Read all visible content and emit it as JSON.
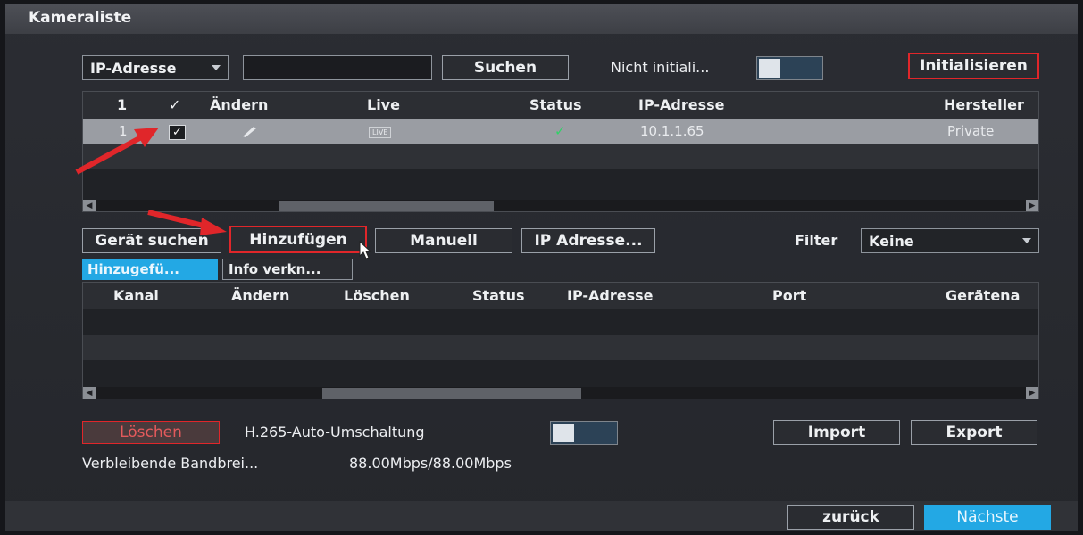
{
  "window": {
    "title": "Kameraliste"
  },
  "search_bar": {
    "type_select": "IP-Adresse",
    "search_value": "",
    "search_button": "Suchen",
    "uninit_label": "Nicht initiali...",
    "init_button": "Initialisieren"
  },
  "device_table": {
    "columns": [
      "1",
      "✓",
      "Ändern",
      "Live",
      "Status",
      "IP-Adresse",
      "Hersteller"
    ],
    "rows": [
      {
        "num": "1",
        "checked": true,
        "live": "LIVE",
        "status": "✓",
        "ip": "10.1.1.65",
        "manufacturer": "Private"
      }
    ]
  },
  "actions": {
    "device_search": "Gerät suchen",
    "add": "Hinzufügen",
    "manual": "Manuell",
    "ip_address": "IP Adresse...",
    "filter_label": "Filter",
    "filter_value": "Keine"
  },
  "tabs": [
    "Hinzugefü...",
    "Info verkn..."
  ],
  "added_table": {
    "columns": [
      "Kanal",
      "Ändern",
      "Löschen",
      "Status",
      "IP-Adresse",
      "Port",
      "Gerätena"
    ]
  },
  "footer": {
    "delete_button": "Löschen",
    "h265_label": "H.265-Auto-Umschaltung",
    "import_button": "Import",
    "export_button": "Export",
    "bandwidth_label": "Verbleibende Bandbrei...",
    "bandwidth_value": "88.00Mbps/88.00Mbps",
    "back_button": "zurück",
    "next_button": "Nächste"
  },
  "colors": {
    "accent": "#23a8e4",
    "highlight": "#e0262a",
    "background": "#2b2d33"
  }
}
